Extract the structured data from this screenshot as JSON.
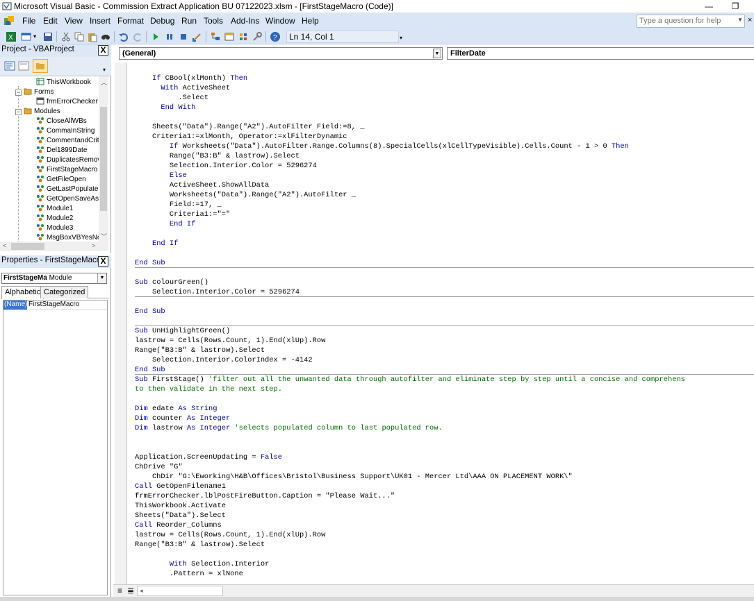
{
  "window": {
    "title": "Microsoft Visual Basic - Commission Extract Application BU 07122023.xlsm - [FirstStageMacro (Code)]",
    "minimize": "—",
    "restore": "❐"
  },
  "menu": {
    "items": [
      "File",
      "Edit",
      "View",
      "Insert",
      "Format",
      "Debug",
      "Run",
      "Tools",
      "Add-Ins",
      "Window",
      "Help"
    ],
    "help_placeholder": "Type a question for help",
    "close_glyph": "×"
  },
  "toolbar": {
    "position": "Ln 14, Col 1"
  },
  "project": {
    "title": "Project - VBAProject",
    "close": "X",
    "tree": [
      {
        "label": "ThisWorkbook",
        "type": "sheet",
        "indent": 3
      },
      {
        "label": "Forms",
        "type": "folder",
        "indent": 1,
        "expander": "−"
      },
      {
        "label": "frmErrorChecker",
        "type": "form",
        "indent": 3
      },
      {
        "label": "Modules",
        "type": "folder",
        "indent": 1,
        "expander": "−"
      },
      {
        "label": "CloseAllWBs",
        "type": "module",
        "indent": 3
      },
      {
        "label": "CommaInString",
        "type": "module",
        "indent": 3
      },
      {
        "label": "CommentandCrit",
        "type": "module",
        "indent": 3
      },
      {
        "label": "Del1899Date",
        "type": "module",
        "indent": 3
      },
      {
        "label": "DuplicatesRemov",
        "type": "module",
        "indent": 3
      },
      {
        "label": "FirstStageMacro",
        "type": "module",
        "indent": 3
      },
      {
        "label": "GetFileOpen",
        "type": "module",
        "indent": 3
      },
      {
        "label": "GetLastPopulate",
        "type": "module",
        "indent": 3
      },
      {
        "label": "GetOpenSaveAs",
        "type": "module",
        "indent": 3
      },
      {
        "label": "Module1",
        "type": "module",
        "indent": 3
      },
      {
        "label": "Module2",
        "type": "module",
        "indent": 3
      },
      {
        "label": "Module3",
        "type": "module",
        "indent": 3
      },
      {
        "label": "MsgBoxVBYesNo",
        "type": "module",
        "indent": 3
      }
    ]
  },
  "properties": {
    "title": "Properties - FirstStageMacro",
    "close": "X",
    "object_name": "FirstStageMa",
    "object_type": "Module",
    "tabs": [
      "Alphabetic",
      "Categorized"
    ],
    "rows": [
      {
        "key": "(Name)",
        "value": "FirstStageMacro"
      }
    ]
  },
  "code": {
    "object_dropdown": "(General)",
    "proc_dropdown": "FilterDate",
    "separators_after": [
      19,
      22,
      25,
      30
    ],
    "lines": [
      [
        [
          "",
          "    "
        ],
        [
          "kw",
          "If "
        ],
        [
          "tx",
          "CBool(xlMonth) "
        ],
        [
          "kw",
          "Then"
        ]
      ],
      [
        [
          "",
          "      "
        ],
        [
          "kw",
          "With "
        ],
        [
          "tx",
          "ActiveSheet"
        ]
      ],
      [
        [
          "tx",
          "          .Select"
        ]
      ],
      [
        [
          "",
          "      "
        ],
        [
          "kw",
          "End With"
        ]
      ],
      [
        [
          "tx",
          ""
        ]
      ],
      [
        [
          "tx",
          "    Sheets(\"Data\").Range(\"A2\").AutoFilter Field:=8, _"
        ]
      ],
      [
        [
          "tx",
          "    Criteria1:=xlMonth, Operator:=xlFilterDynamic"
        ]
      ],
      [
        [
          "",
          "        "
        ],
        [
          "kw",
          "If "
        ],
        [
          "tx",
          "Worksheets(\"Data\").AutoFilter.Range.Columns(8).SpecialCells(xlCellTypeVisible).Cells.Count - 1 > 0 "
        ],
        [
          "kw",
          "Then"
        ]
      ],
      [
        [
          "tx",
          "        Range(\"B3:B\" & lastrow).Select"
        ]
      ],
      [
        [
          "tx",
          "        Selection.Interior.Color = 5296274"
        ]
      ],
      [
        [
          "",
          "        "
        ],
        [
          "kw",
          "Else"
        ]
      ],
      [
        [
          "tx",
          "        ActiveSheet.ShowAllData"
        ]
      ],
      [
        [
          "tx",
          "        Worksheets(\"Data\").Range(\"A2\").AutoFilter _"
        ]
      ],
      [
        [
          "tx",
          "        Field:=17, _"
        ]
      ],
      [
        [
          "tx",
          "        Criteria1:=\"=\""
        ]
      ],
      [
        [
          "",
          "        "
        ],
        [
          "kw",
          "End If"
        ]
      ],
      [
        [
          "tx",
          ""
        ]
      ],
      [
        [
          "",
          "    "
        ],
        [
          "kw",
          "End If"
        ]
      ],
      [
        [
          "tx",
          ""
        ]
      ],
      [
        [
          "kw",
          "End Sub"
        ]
      ],
      [
        [
          "tx",
          ""
        ]
      ],
      [
        [
          "kw",
          "Sub "
        ],
        [
          "tx",
          "colourGreen()"
        ]
      ],
      [
        [
          "tx",
          "    Selection.Interior.Color = 5296274"
        ]
      ],
      [
        [
          "tx",
          ""
        ]
      ],
      [
        [
          "kw",
          "End Sub"
        ]
      ],
      [
        [
          "tx",
          ""
        ]
      ],
      [
        [
          "kw",
          "Sub "
        ],
        [
          "tx",
          "UnHighlightGreen()"
        ]
      ],
      [
        [
          "tx",
          "lastrow = Cells(Rows.Count, 1).End(xlUp).Row"
        ]
      ],
      [
        [
          "tx",
          "Range(\"B3:B\" & lastrow).Select"
        ]
      ],
      [
        [
          "tx",
          "    Selection.Interior.ColorIndex = -4142"
        ]
      ],
      [
        [
          "kw",
          "End Sub"
        ]
      ],
      [
        [
          "kw",
          "Sub "
        ],
        [
          "tx",
          "FirstStage() "
        ],
        [
          "cm",
          "'filter out all the unwanted data through autofilter and eliminate step by step until a concise and comprehens"
        ]
      ],
      [
        [
          "cm",
          "to then validate in the next step."
        ]
      ],
      [
        [
          "tx",
          ""
        ]
      ],
      [
        [
          "kw",
          "Dim "
        ],
        [
          "tx",
          "edate "
        ],
        [
          "kw",
          "As String"
        ]
      ],
      [
        [
          "kw",
          "Dim "
        ],
        [
          "tx",
          "counter "
        ],
        [
          "kw",
          "As Integer"
        ]
      ],
      [
        [
          "kw",
          "Dim "
        ],
        [
          "tx",
          "lastrow "
        ],
        [
          "kw",
          "As Integer "
        ],
        [
          "cm",
          "'selects populated column to last populated row."
        ]
      ],
      [
        [
          "tx",
          ""
        ]
      ],
      [
        [
          "tx",
          ""
        ]
      ],
      [
        [
          "tx",
          "Application.ScreenUpdating = "
        ],
        [
          "kw",
          "False"
        ]
      ],
      [
        [
          "tx",
          "ChDrive \"G\""
        ]
      ],
      [
        [
          "tx",
          "    ChDir \"G:\\Eworking\\H&B\\Offices\\Bristol\\Business Support\\UK01 - Mercer Ltd\\AAA ON PLACEMENT WORK\\\""
        ]
      ],
      [
        [
          "kw",
          "Call "
        ],
        [
          "tx",
          "GetOpenFilename1"
        ]
      ],
      [
        [
          "tx",
          "frmErrorChecker.lblPostFireButton.Caption = \"Please Wait...\""
        ]
      ],
      [
        [
          "tx",
          "ThisWorkbook.Activate"
        ]
      ],
      [
        [
          "tx",
          "Sheets(\"Data\").Select"
        ]
      ],
      [
        [
          "kw",
          "Call "
        ],
        [
          "tx",
          "Reorder_Columns"
        ]
      ],
      [
        [
          "tx",
          "lastrow = Cells(Rows.Count, 1).End(xlUp).Row"
        ]
      ],
      [
        [
          "tx",
          "Range(\"B3:B\" & lastrow).Select"
        ]
      ],
      [
        [
          "tx",
          ""
        ]
      ],
      [
        [
          "",
          "        "
        ],
        [
          "kw",
          "With "
        ],
        [
          "tx",
          "Selection.Interior"
        ]
      ],
      [
        [
          "tx",
          "        .Pattern = xlNone"
        ]
      ]
    ]
  }
}
